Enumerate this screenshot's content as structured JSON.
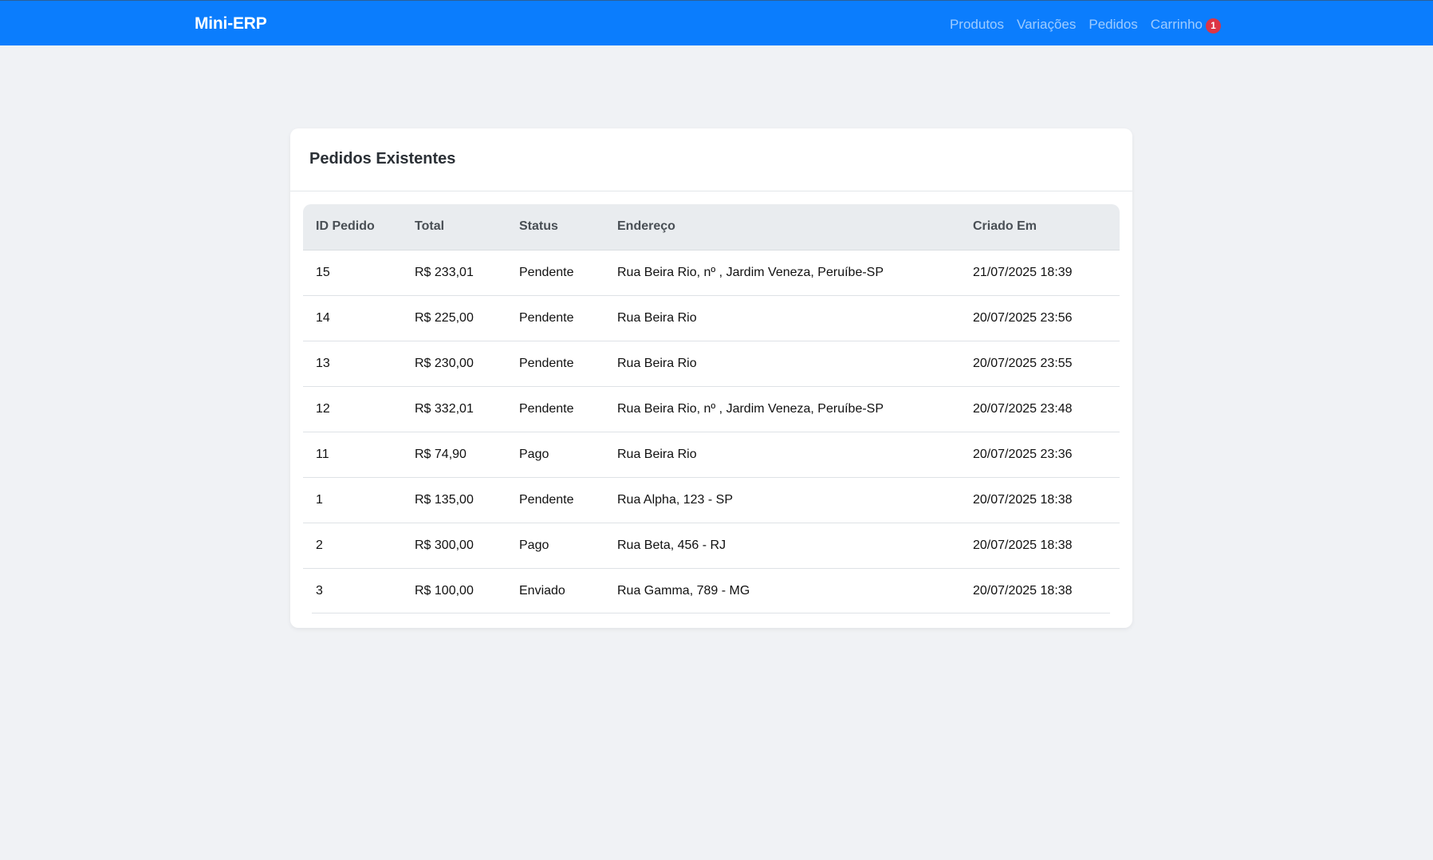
{
  "navbar": {
    "brand": "Mini-ERP",
    "links": [
      {
        "label": "Produtos"
      },
      {
        "label": "Variações"
      },
      {
        "label": "Pedidos"
      },
      {
        "label": "Carrinho",
        "badge": "1"
      }
    ],
    "colors": {
      "background": "#0b7dfd",
      "badge": "#dc3545"
    }
  },
  "card": {
    "title": "Pedidos Existentes"
  },
  "table": {
    "headers": [
      "ID Pedido",
      "Total",
      "Status",
      "Endereço",
      "Criado Em"
    ],
    "rows": [
      {
        "id": "15",
        "total": "R$ 233,01",
        "status": "Pendente",
        "address": "Rua Beira Rio, nº , Jardim Veneza, Peruíbe-SP",
        "created": "21/07/2025 18:39"
      },
      {
        "id": "14",
        "total": "R$ 225,00",
        "status": "Pendente",
        "address": "Rua Beira Rio",
        "created": "20/07/2025 23:56"
      },
      {
        "id": "13",
        "total": "R$ 230,00",
        "status": "Pendente",
        "address": "Rua Beira Rio",
        "created": "20/07/2025 23:55"
      },
      {
        "id": "12",
        "total": "R$ 332,01",
        "status": "Pendente",
        "address": "Rua Beira Rio, nº , Jardim Veneza, Peruíbe-SP",
        "created": "20/07/2025 23:48"
      },
      {
        "id": "11",
        "total": "R$ 74,90",
        "status": "Pago",
        "address": "Rua Beira Rio",
        "created": "20/07/2025 23:36"
      },
      {
        "id": "1",
        "total": "R$ 135,00",
        "status": "Pendente",
        "address": "Rua Alpha, 123 - SP",
        "created": "20/07/2025 18:38"
      },
      {
        "id": "2",
        "total": "R$ 300,00",
        "status": "Pago",
        "address": "Rua Beta, 456 - RJ",
        "created": "20/07/2025 18:38"
      },
      {
        "id": "3",
        "total": "R$ 100,00",
        "status": "Enviado",
        "address": "Rua Gamma, 789 - MG",
        "created": "20/07/2025 18:38"
      }
    ]
  }
}
